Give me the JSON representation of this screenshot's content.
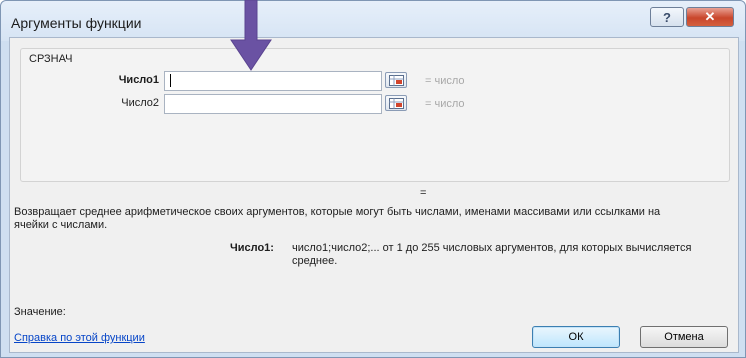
{
  "window": {
    "title": "Аргументы функции",
    "help_glyph": "?",
    "close_glyph": "✕"
  },
  "function": {
    "name": "СРЗНАЧ",
    "args": [
      {
        "label": "Число1",
        "value": "",
        "result": "= число",
        "bold": true
      },
      {
        "label": "Число2",
        "value": "",
        "result": "= число",
        "bold": false
      }
    ],
    "result_sign": "=",
    "description": "Возвращает среднее арифметическое своих аргументов, которые могут быть числами, именами массивами или ссылками на ячейки с числами.",
    "arg_help": {
      "name": "Число1:",
      "text": "число1;число2;... от 1 до 255 числовых аргументов, для которых вычисляется среднее."
    }
  },
  "footer": {
    "value_label": "Значение:",
    "help_link": "Справка по этой функции",
    "ok_label": "ОК",
    "cancel_label": "Отмена"
  },
  "colors": {
    "arrow": "#6a52a3",
    "link": "#0645c8",
    "muted_result": "#a8a8a8"
  },
  "icons": [
    "help-icon",
    "close-icon",
    "range-select-icon",
    "pointer-arrow-icon"
  ]
}
